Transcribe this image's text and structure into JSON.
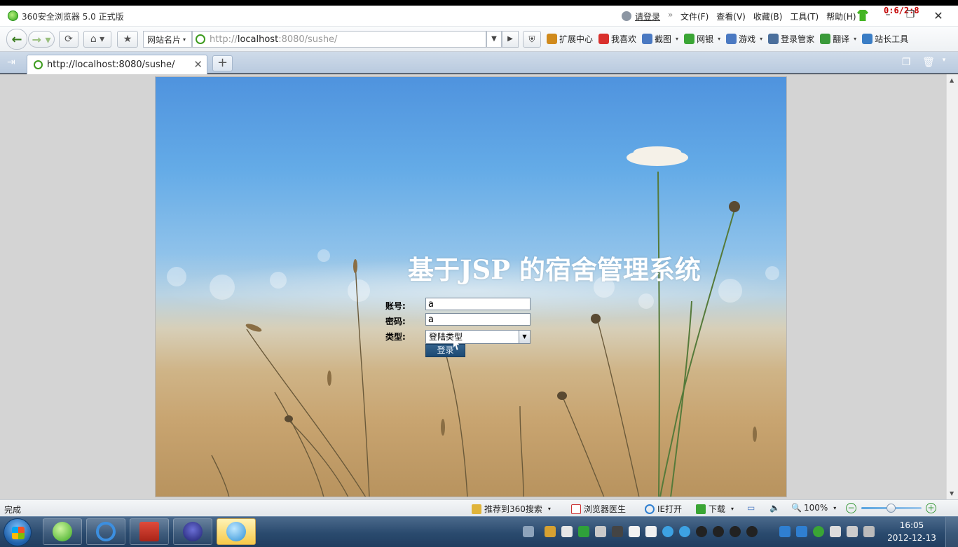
{
  "window": {
    "title": "360安全浏览器 5.0 正式版",
    "login_link": "请登录",
    "menu": [
      "文件(F)",
      "查看(V)",
      "收藏(B)",
      "工具(T)",
      "帮助(H)"
    ],
    "recorder_text": "0:6/2:8"
  },
  "navbar": {
    "site_card_label": "网站名片",
    "address": {
      "scheme": "http://",
      "host": "localhost",
      "rest": ":8080/sushe/"
    },
    "tools": [
      {
        "label": "扩展中心",
        "icon": "extension-icon",
        "color": "#d08a1c"
      },
      {
        "label": "我喜欢",
        "icon": "heart-icon",
        "color": "#d9302c"
      },
      {
        "label": "截图",
        "icon": "screenshot-icon",
        "color": "#4a79c2"
      },
      {
        "label": "网银",
        "icon": "bank-icon",
        "color": "#3aa535"
      },
      {
        "label": "游戏",
        "icon": "game-icon",
        "color": "#4a79c2"
      },
      {
        "label": "登录管家",
        "icon": "key-icon",
        "color": "#4b6f9c"
      },
      {
        "label": "翻译",
        "icon": "translate-icon",
        "color": "#3a9a3a"
      },
      {
        "label": "站长工具",
        "icon": "webmaster-icon",
        "color": "#3a7dc5"
      }
    ]
  },
  "tabs": [
    {
      "title": "http://localhost:8080/sushe/"
    }
  ],
  "page": {
    "heading": "基于JSP 的宿舍管理系统",
    "form": {
      "account_label": "账号:",
      "account_value": "a",
      "password_label": "密码:",
      "password_value": "a",
      "type_label": "类型:",
      "type_selected": "登陆类型",
      "submit_label": "登录"
    }
  },
  "statusbar": {
    "status": "完成",
    "items": [
      {
        "label": "推荐到360搜索",
        "icon": "thumbs-up-icon"
      },
      {
        "label": "浏览器医生",
        "icon": "doctor-icon"
      },
      {
        "label": "IE打开",
        "icon": "ie-icon"
      },
      {
        "label": "下载",
        "icon": "download-icon"
      }
    ],
    "zoom": "100%",
    "zoom_level": 1.0
  },
  "taskbar": {
    "apps": [
      {
        "name": "360-browser",
        "icon": "browser-360-icon"
      },
      {
        "name": "internet-explorer",
        "icon": "ie-icon"
      },
      {
        "name": "toolbox",
        "icon": "toolbox-icon"
      },
      {
        "name": "eclipse",
        "icon": "eclipse-icon"
      },
      {
        "name": "qq-chat",
        "icon": "qq-icon"
      }
    ],
    "time": "16:05",
    "date": "2012-12-13"
  }
}
